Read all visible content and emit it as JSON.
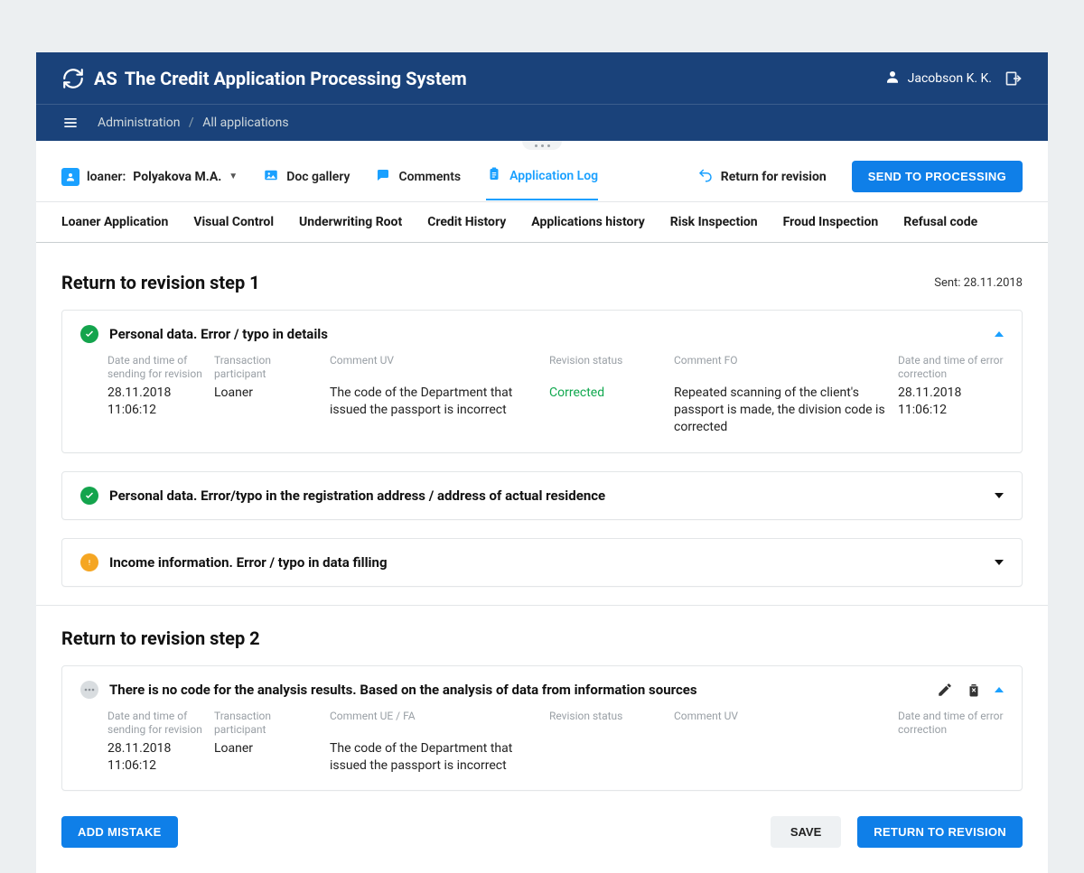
{
  "header": {
    "short": "AS",
    "title": "The Credit Application Processing System",
    "user": "Jacobson K. K."
  },
  "breadcrumb": {
    "level1": "Administration",
    "level2": "All applications"
  },
  "actions": {
    "loaner_prefix": "loaner:",
    "loaner_name": "Polyakova M.A.",
    "doc_gallery": "Doc gallery",
    "comments": "Comments",
    "application_log": "Application Log",
    "return_for_revision": "Return for revision",
    "send_to_processing": "SEND TO PROCESSING"
  },
  "tabs": [
    "Loaner Application",
    "Visual Control",
    "Underwriting Root",
    "Credit History",
    "Applications history",
    "Risk Inspection",
    "Froud Inspection",
    "Refusal code"
  ],
  "step1": {
    "title": "Return to revision step 1",
    "sent_label": "Sent: 28.11.2018",
    "cards": [
      {
        "status": "ok",
        "title": "Personal data. Error / typo in details",
        "headers": {
          "h1": "Date and time of sending for revision",
          "h2": "Transaction participant",
          "h3": "Comment UV",
          "h4": "Revision status",
          "h5": "Comment FO",
          "h6": "Date and time of error correction"
        },
        "values": {
          "v1a": "28.11.2018",
          "v1b": "11:06:12",
          "v2": "Loaner",
          "v3": "The code of the Department that issued the passport is incorrect",
          "v4": "Corrected",
          "v5": "Repeated scanning of the client's passport is made, the division code is corrected",
          "v6a": "28.11.2018",
          "v6b": "11:06:12"
        }
      },
      {
        "status": "ok",
        "title": "Personal data. Error/typo in the registration address / address of actual residence"
      },
      {
        "status": "warn",
        "title": "Income information. Error / typo in data filling"
      }
    ]
  },
  "step2": {
    "title": "Return to revision step 2",
    "card": {
      "status": "neutral",
      "title": "There is no code for the analysis results. Based on the analysis of data from information sources",
      "headers": {
        "h1": "Date and time of sending for revision",
        "h2": "Transaction participant",
        "h3": "Comment UE / FA",
        "h4": "Revision status",
        "h5": "Comment UV",
        "h6": "Date and time of error correction"
      },
      "values": {
        "v1a": "28.11.2018",
        "v1b": "11:06:12",
        "v2": "Loaner",
        "v3": "The code of the Department that issued the passport is incorrect"
      }
    }
  },
  "footer": {
    "add_mistake": "ADD MISTAKE",
    "save": "SAVE",
    "return_to_revision": "RETURN TO REVISION"
  }
}
